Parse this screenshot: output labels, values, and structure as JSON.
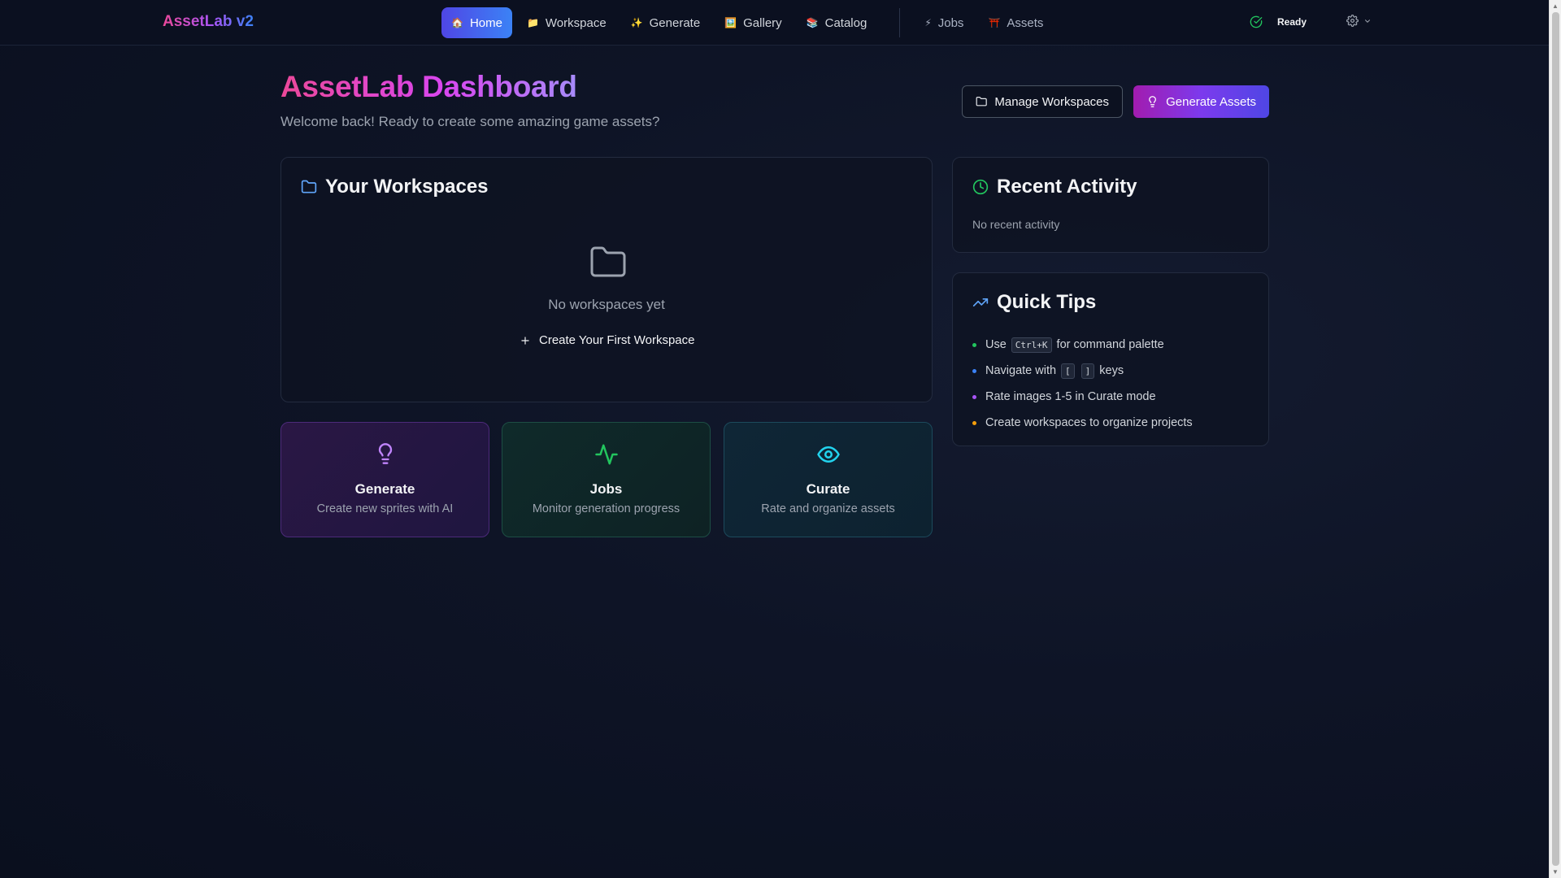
{
  "app": {
    "brand": "AssetLab v2"
  },
  "nav": {
    "items": [
      {
        "label": "Home",
        "icon": "house-icon",
        "active": true
      },
      {
        "label": "Workspace",
        "icon": "folder-icon"
      },
      {
        "label": "Generate",
        "icon": "sparkles-icon"
      },
      {
        "label": "Gallery",
        "icon": "picture-icon"
      },
      {
        "label": "Catalog",
        "icon": "books-icon"
      }
    ],
    "secondary": [
      {
        "label": "Jobs",
        "icon": "lightning-icon"
      },
      {
        "label": "Assets",
        "icon": "torii-icon"
      }
    ],
    "status": "Ready"
  },
  "header": {
    "title": "AssetLab Dashboard",
    "subtitle": "Welcome back! Ready to create some amazing game assets?",
    "manage_label": "Manage Workspaces",
    "generate_label": "Generate Assets"
  },
  "workspaces": {
    "title": "Your Workspaces",
    "empty_text": "No workspaces yet",
    "create_label": "Create Your First Workspace"
  },
  "activity": {
    "title": "Recent Activity",
    "empty_text": "No recent activity"
  },
  "tips": {
    "title": "Quick Tips",
    "items": {
      "t1": {
        "pre": "Use",
        "key": "Ctrl+K",
        "post": "for command palette"
      },
      "t2": {
        "pre": "Navigate with",
        "key1": "[",
        "key2": "]",
        "post": "keys"
      },
      "t3": {
        "text": "Rate images 1-5 in Curate mode"
      },
      "t4": {
        "text": "Create workspaces to organize projects"
      }
    },
    "dot_colors": [
      "#22c55e",
      "#3b82f6",
      "#a855f7",
      "#f59e0b"
    ]
  },
  "features": [
    {
      "title": "Generate",
      "desc": "Create new sprites with AI",
      "icon": "lightbulb-icon",
      "color": "#c084fc"
    },
    {
      "title": "Jobs",
      "desc": "Monitor generation progress",
      "icon": "activity-icon",
      "color": "#22c55e"
    },
    {
      "title": "Curate",
      "desc": "Rate and organize assets",
      "icon": "eye-icon",
      "color": "#22d3ee"
    }
  ]
}
